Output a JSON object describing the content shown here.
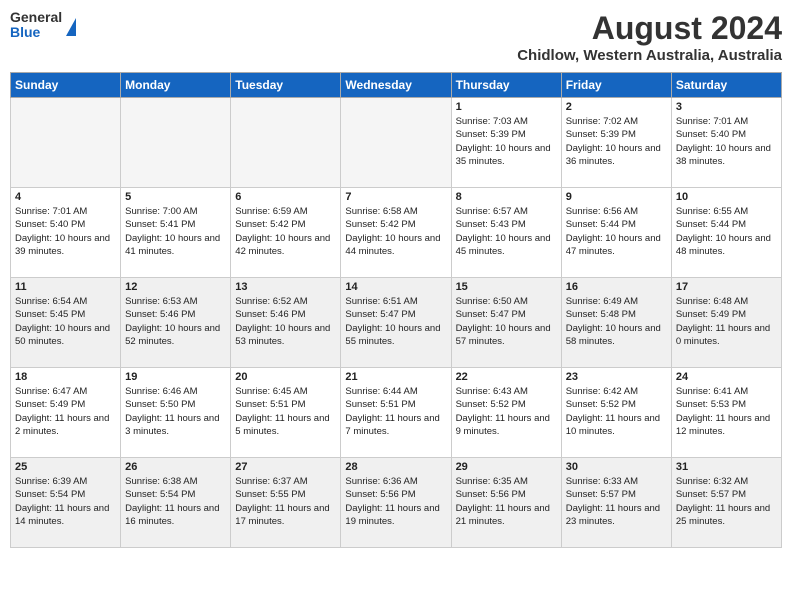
{
  "header": {
    "logo": {
      "general": "General",
      "blue": "Blue"
    },
    "month_year": "August 2024",
    "location": "Chidlow, Western Australia, Australia"
  },
  "days_of_week": [
    "Sunday",
    "Monday",
    "Tuesday",
    "Wednesday",
    "Thursday",
    "Friday",
    "Saturday"
  ],
  "weeks": [
    [
      {
        "day": "",
        "empty": true
      },
      {
        "day": "",
        "empty": true
      },
      {
        "day": "",
        "empty": true
      },
      {
        "day": "",
        "empty": true
      },
      {
        "day": "1",
        "sunrise": "7:03 AM",
        "sunset": "5:39 PM",
        "daylight": "10 hours and 35 minutes."
      },
      {
        "day": "2",
        "sunrise": "7:02 AM",
        "sunset": "5:39 PM",
        "daylight": "10 hours and 36 minutes."
      },
      {
        "day": "3",
        "sunrise": "7:01 AM",
        "sunset": "5:40 PM",
        "daylight": "10 hours and 38 minutes."
      }
    ],
    [
      {
        "day": "4",
        "sunrise": "7:01 AM",
        "sunset": "5:40 PM",
        "daylight": "10 hours and 39 minutes."
      },
      {
        "day": "5",
        "sunrise": "7:00 AM",
        "sunset": "5:41 PM",
        "daylight": "10 hours and 41 minutes."
      },
      {
        "day": "6",
        "sunrise": "6:59 AM",
        "sunset": "5:42 PM",
        "daylight": "10 hours and 42 minutes."
      },
      {
        "day": "7",
        "sunrise": "6:58 AM",
        "sunset": "5:42 PM",
        "daylight": "10 hours and 44 minutes."
      },
      {
        "day": "8",
        "sunrise": "6:57 AM",
        "sunset": "5:43 PM",
        "daylight": "10 hours and 45 minutes."
      },
      {
        "day": "9",
        "sunrise": "6:56 AM",
        "sunset": "5:44 PM",
        "daylight": "10 hours and 47 minutes."
      },
      {
        "day": "10",
        "sunrise": "6:55 AM",
        "sunset": "5:44 PM",
        "daylight": "10 hours and 48 minutes."
      }
    ],
    [
      {
        "day": "11",
        "sunrise": "6:54 AM",
        "sunset": "5:45 PM",
        "daylight": "10 hours and 50 minutes."
      },
      {
        "day": "12",
        "sunrise": "6:53 AM",
        "sunset": "5:46 PM",
        "daylight": "10 hours and 52 minutes."
      },
      {
        "day": "13",
        "sunrise": "6:52 AM",
        "sunset": "5:46 PM",
        "daylight": "10 hours and 53 minutes."
      },
      {
        "day": "14",
        "sunrise": "6:51 AM",
        "sunset": "5:47 PM",
        "daylight": "10 hours and 55 minutes."
      },
      {
        "day": "15",
        "sunrise": "6:50 AM",
        "sunset": "5:47 PM",
        "daylight": "10 hours and 57 minutes."
      },
      {
        "day": "16",
        "sunrise": "6:49 AM",
        "sunset": "5:48 PM",
        "daylight": "10 hours and 58 minutes."
      },
      {
        "day": "17",
        "sunrise": "6:48 AM",
        "sunset": "5:49 PM",
        "daylight": "11 hours and 0 minutes."
      }
    ],
    [
      {
        "day": "18",
        "sunrise": "6:47 AM",
        "sunset": "5:49 PM",
        "daylight": "11 hours and 2 minutes."
      },
      {
        "day": "19",
        "sunrise": "6:46 AM",
        "sunset": "5:50 PM",
        "daylight": "11 hours and 3 minutes."
      },
      {
        "day": "20",
        "sunrise": "6:45 AM",
        "sunset": "5:51 PM",
        "daylight": "11 hours and 5 minutes."
      },
      {
        "day": "21",
        "sunrise": "6:44 AM",
        "sunset": "5:51 PM",
        "daylight": "11 hours and 7 minutes."
      },
      {
        "day": "22",
        "sunrise": "6:43 AM",
        "sunset": "5:52 PM",
        "daylight": "11 hours and 9 minutes."
      },
      {
        "day": "23",
        "sunrise": "6:42 AM",
        "sunset": "5:52 PM",
        "daylight": "11 hours and 10 minutes."
      },
      {
        "day": "24",
        "sunrise": "6:41 AM",
        "sunset": "5:53 PM",
        "daylight": "11 hours and 12 minutes."
      }
    ],
    [
      {
        "day": "25",
        "sunrise": "6:39 AM",
        "sunset": "5:54 PM",
        "daylight": "11 hours and 14 minutes."
      },
      {
        "day": "26",
        "sunrise": "6:38 AM",
        "sunset": "5:54 PM",
        "daylight": "11 hours and 16 minutes."
      },
      {
        "day": "27",
        "sunrise": "6:37 AM",
        "sunset": "5:55 PM",
        "daylight": "11 hours and 17 minutes."
      },
      {
        "day": "28",
        "sunrise": "6:36 AM",
        "sunset": "5:56 PM",
        "daylight": "11 hours and 19 minutes."
      },
      {
        "day": "29",
        "sunrise": "6:35 AM",
        "sunset": "5:56 PM",
        "daylight": "11 hours and 21 minutes."
      },
      {
        "day": "30",
        "sunrise": "6:33 AM",
        "sunset": "5:57 PM",
        "daylight": "11 hours and 23 minutes."
      },
      {
        "day": "31",
        "sunrise": "6:32 AM",
        "sunset": "5:57 PM",
        "daylight": "11 hours and 25 minutes."
      }
    ]
  ]
}
